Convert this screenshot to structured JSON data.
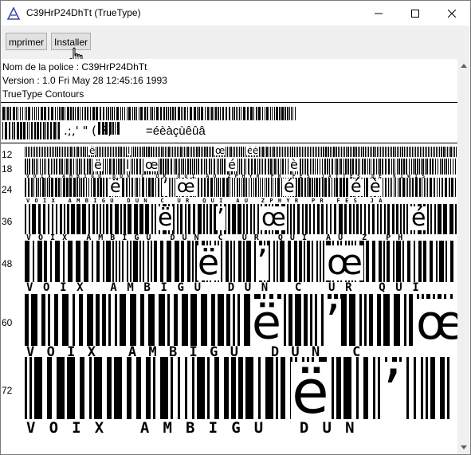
{
  "window": {
    "title": "C39HrP24DhTt (TrueType)",
    "minimize_icon": "minimize-icon",
    "maximize_icon": "maximize-icon",
    "close_icon": "close-icon"
  },
  "toolbar": {
    "print_label": "mprimer",
    "install_label": "Installer"
  },
  "info": {
    "font_name_line": "Nom de la police : C39HrP24DhTt",
    "version_line": "Version : 1.0 Fri May 28 12:45:16 1993",
    "type_line": "TrueType  Contours"
  },
  "charset": {
    "line2_visible_text": ".;,' \" (!?)",
    "line2_accents": "=éèàçùêûâ"
  },
  "samples": [
    {
      "size": "12",
      "caption": "",
      "glyphs": [
        "ë",
        "l",
        "œ",
        "é",
        "è"
      ]
    },
    {
      "size": "18",
      "caption": "V O I X   A M B I G U   D U N   C   U R   Q U I   A U   Z P H Y R   P R   F E S   J A T T E S   D E   K I W I S",
      "glyphs": [
        "ë",
        "l",
        "œ",
        "é",
        "è"
      ]
    },
    {
      "size": "24",
      "caption": "V O I X   A M B I G U   D U N   C   U R   Q U I   A U   Z P H Y R   P R   F E S   J A",
      "glyphs": [
        "ë",
        "ʼ",
        "œ",
        "é",
        "é",
        "è"
      ]
    },
    {
      "size": "36",
      "caption": "V O I X   A M B I G U   D U N   C   U R   Q U I   A U   Z   P H",
      "glyphs": [
        "ë",
        "ʼ",
        "œ",
        "é"
      ]
    },
    {
      "size": "48",
      "caption": "V O I X   A M B I G U   D U N   C   U R   Q U I",
      "glyphs": [
        "ë",
        "ʼ",
        "œ"
      ]
    },
    {
      "size": "60",
      "caption": "V O I X   A M B I G U   D U N   C",
      "glyphs": [
        "ë",
        "ʼ",
        "œ"
      ]
    },
    {
      "size": "72",
      "caption": "V O I X   A M B I G U   D U N",
      "glyphs": [
        "ë",
        "ʼ"
      ]
    }
  ],
  "colors": {
    "titlebar": "#ffffff",
    "toolbar": "#f0f0f0",
    "content": "#ffffff",
    "ink": "#000000"
  }
}
